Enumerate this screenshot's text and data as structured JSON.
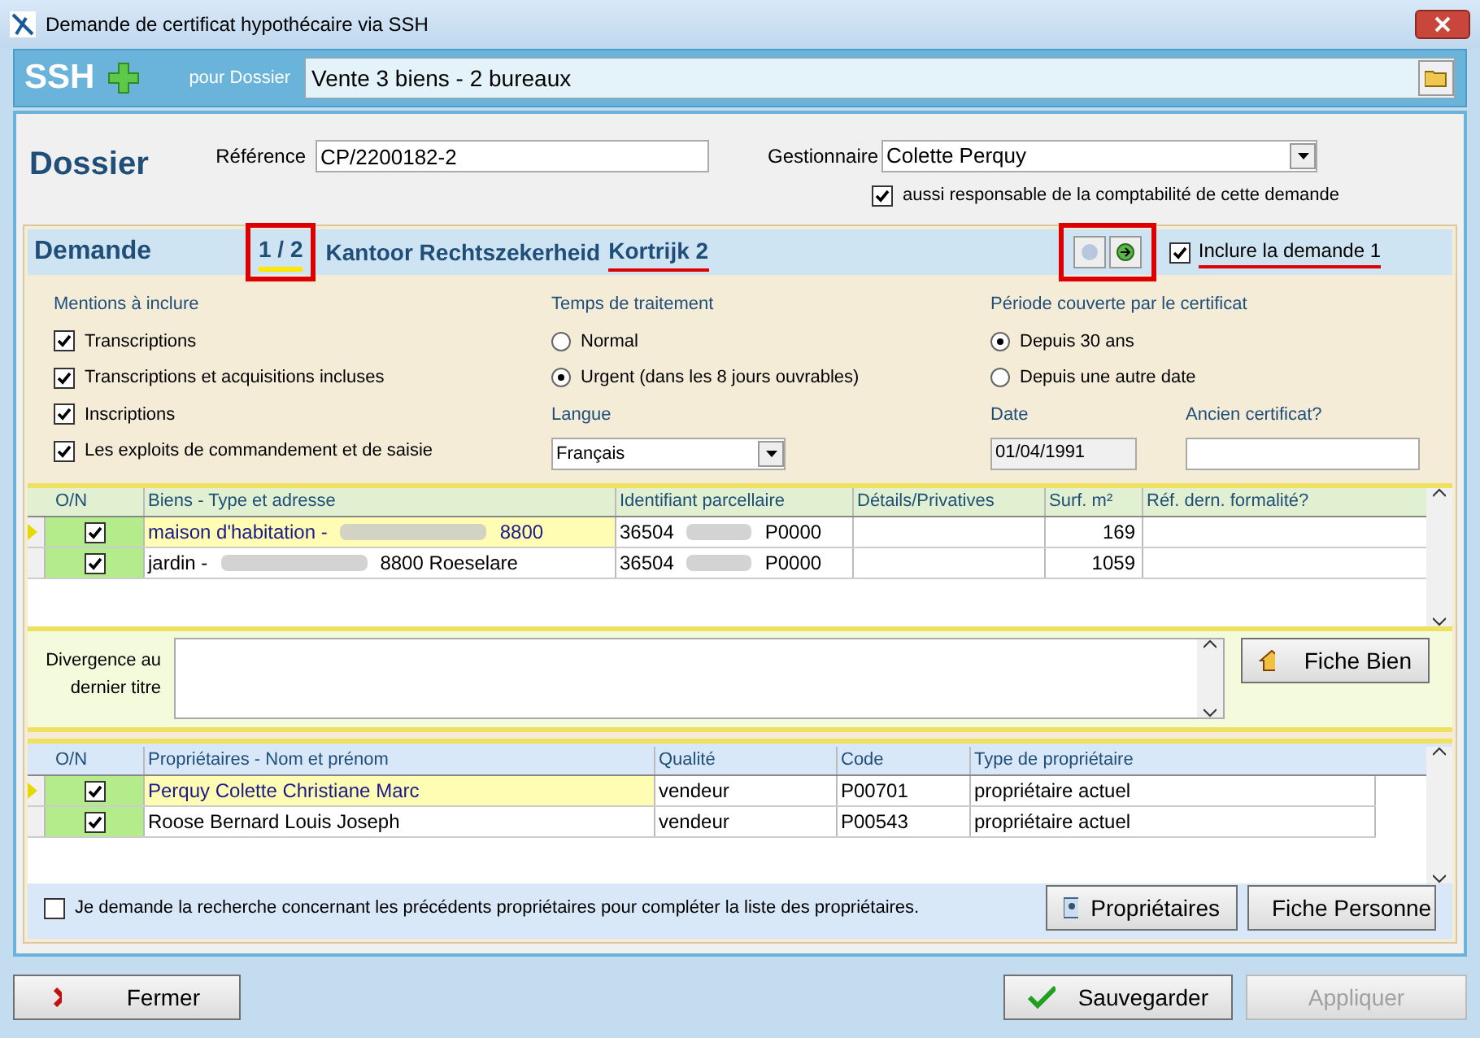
{
  "window": {
    "title": "Demande de certificat hypothécaire via SSH"
  },
  "header": {
    "logo": "SSH",
    "dossier_label": "pour Dossier",
    "dossier_value": "Vente  3 biens - 2 bureaux"
  },
  "dossier": {
    "title": "Dossier",
    "reference_label": "Référence",
    "reference_value": "CP/2200182-2",
    "gestionnaire_label": "Gestionnaire",
    "gestionnaire_value": "Colette Perquy",
    "compta_checkbox": {
      "label": "aussi responsable de la comptabilité de cette demande",
      "checked": true
    }
  },
  "demande": {
    "title": "Demande",
    "counter": "1 / 2",
    "office_name": "Kantoor Rechtszekerheid",
    "office_city": "Kortrijk 2",
    "include": {
      "label": "Inclure la demande 1",
      "checked": true
    }
  },
  "mentions": {
    "title": "Mentions à inclure",
    "items": [
      {
        "label": "Transcriptions",
        "checked": true
      },
      {
        "label": "Transcriptions et acquisitions incluses",
        "checked": true
      },
      {
        "label": "Inscriptions",
        "checked": true
      },
      {
        "label": "Les exploits de commandement et de saisie",
        "checked": true
      }
    ]
  },
  "temps": {
    "title": "Temps de traitement",
    "options": [
      {
        "label": "Normal",
        "selected": false
      },
      {
        "label": "Urgent (dans les 8 jours ouvrables)",
        "selected": true
      }
    ]
  },
  "langue": {
    "label": "Langue",
    "value": "Français"
  },
  "periode": {
    "title": "Période couverte par le certificat",
    "options": [
      {
        "label": "Depuis 30 ans",
        "selected": true
      },
      {
        "label": "Depuis une autre date",
        "selected": false
      }
    ]
  },
  "date": {
    "label": "Date",
    "value": "01/04/1991"
  },
  "ancien": {
    "label": "Ancien certificat?"
  },
  "biens": {
    "columns": [
      "O/N",
      "Biens - Type et adresse",
      "Identifiant parcellaire",
      "Détails/Privatives",
      "Surf. m²",
      "Réf. dern. formalité?"
    ],
    "rows": [
      {
        "selected": true,
        "checked": true,
        "type": "maison d'habitation  -",
        "address_end": "8800",
        "parcel_start": "36504",
        "parcel_end": "P0000",
        "surface": "169"
      },
      {
        "selected": false,
        "checked": true,
        "type": "jardin  -",
        "address_end": "8800 Roeselare",
        "parcel_start": "36504",
        "parcel_end": "P0000",
        "surface": "1059"
      }
    ]
  },
  "divergence": {
    "label": "Divergence au dernier titre",
    "button": "Fiche Bien"
  },
  "proprietaires": {
    "columns": [
      "O/N",
      "Propriétaires - Nom et prénom",
      "Qualité",
      "Code",
      "Type de propriétaire"
    ],
    "rows": [
      {
        "selected": true,
        "checked": true,
        "name": "Perquy Colette Christiane Marc",
        "qualite": "vendeur",
        "code": "P00701",
        "type": "propriétaire actuel"
      },
      {
        "selected": false,
        "checked": true,
        "name": "Roose Bernard Louis Joseph",
        "qualite": "vendeur",
        "code": "P00543",
        "type": "propriétaire actuel"
      }
    ]
  },
  "recherche": {
    "label": "Je demande la recherche concernant les précédents propriétaires pour compléter la liste des propriétaires.",
    "checked": false
  },
  "buttons": {
    "proprietaires": "Propriétaires",
    "fiche_personne": "Fiche Personne",
    "fermer": "Fermer",
    "sauvegarder": "Sauvegarder",
    "appliquer": "Appliquer"
  }
}
